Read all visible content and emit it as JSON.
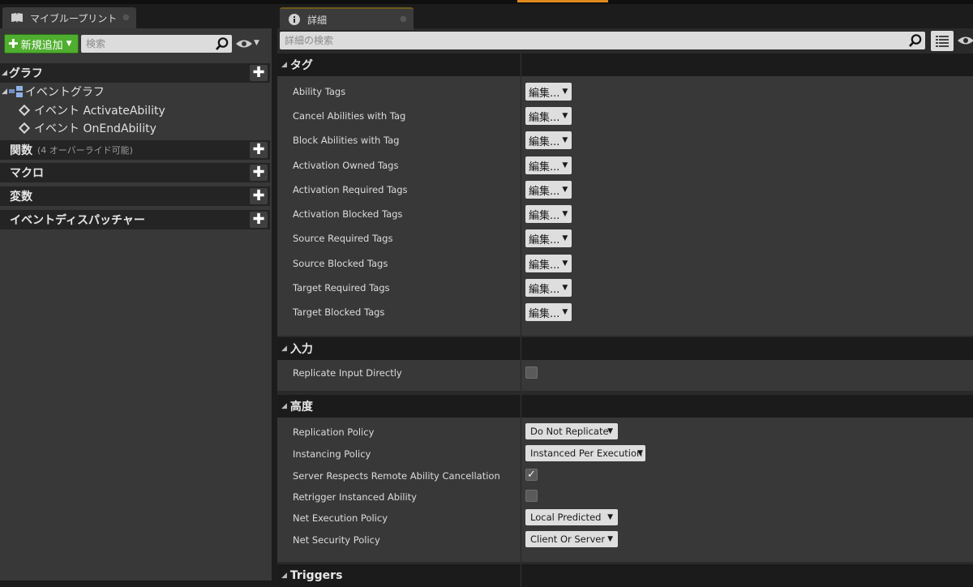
{
  "left_panel": {
    "tab_label": "マイブループリント",
    "add_button_label": "新規追加",
    "search_placeholder": "検索",
    "sections": [
      {
        "title": "グラフ",
        "subtitle": ""
      },
      {
        "title": "関数",
        "subtitle": "(4 オーバーライド可能)"
      },
      {
        "title": "マクロ",
        "subtitle": ""
      },
      {
        "title": "変数",
        "subtitle": ""
      },
      {
        "title": "イベントディスパッチャー",
        "subtitle": ""
      }
    ],
    "tree": {
      "event_graph": "イベントグラフ",
      "events": [
        "イベント ActivateAbility",
        "イベント OnEndAbility"
      ]
    }
  },
  "right_panel": {
    "tab_label": "詳細",
    "search_placeholder": "詳細の検索",
    "categories": [
      {
        "title": "タグ",
        "properties": [
          {
            "label": "Ability Tags",
            "value": "編集..."
          },
          {
            "label": "Cancel Abilities with Tag",
            "value": "編集..."
          },
          {
            "label": "Block Abilities with Tag",
            "value": "編集..."
          },
          {
            "label": "Activation Owned Tags",
            "value": "編集..."
          },
          {
            "label": "Activation Required Tags",
            "value": "編集..."
          },
          {
            "label": "Activation Blocked Tags",
            "value": "編集..."
          },
          {
            "label": "Source Required Tags",
            "value": "編集..."
          },
          {
            "label": "Source Blocked Tags",
            "value": "編集..."
          },
          {
            "label": "Target Required Tags",
            "value": "編集..."
          },
          {
            "label": "Target Blocked Tags",
            "value": "編集..."
          }
        ]
      },
      {
        "title": "入力",
        "properties": [
          {
            "label": "Replicate Input Directly",
            "checked": false
          }
        ]
      },
      {
        "title": "高度",
        "properties": [
          {
            "label": "Replication Policy",
            "value": "Do Not Replicate"
          },
          {
            "label": "Instancing Policy",
            "value": "Instanced Per Execution"
          },
          {
            "label": "Server Respects Remote Ability Cancellation",
            "checked": true
          },
          {
            "label": "Retrigger Instanced Ability",
            "checked": false
          },
          {
            "label": "Net Execution Policy",
            "value": "Local Predicted"
          },
          {
            "label": "Net Security Policy",
            "value": "Client Or Server"
          }
        ]
      },
      {
        "title": "Triggers",
        "properties": []
      }
    ]
  },
  "colors": {
    "add_button": "#4fae2f",
    "panel_bg": "#383838",
    "header_bg": "#1b1b1b",
    "tab_accent": "#e08a1e"
  },
  "icons": {
    "left_tab": "blueprint-book-icon",
    "right_tab": "info-icon",
    "search": "magnifier-icon",
    "visibility": "eye-icon",
    "view_options": "grid-view-icon",
    "event": "diamond-event-icon",
    "graph": "event-graph-icon"
  }
}
